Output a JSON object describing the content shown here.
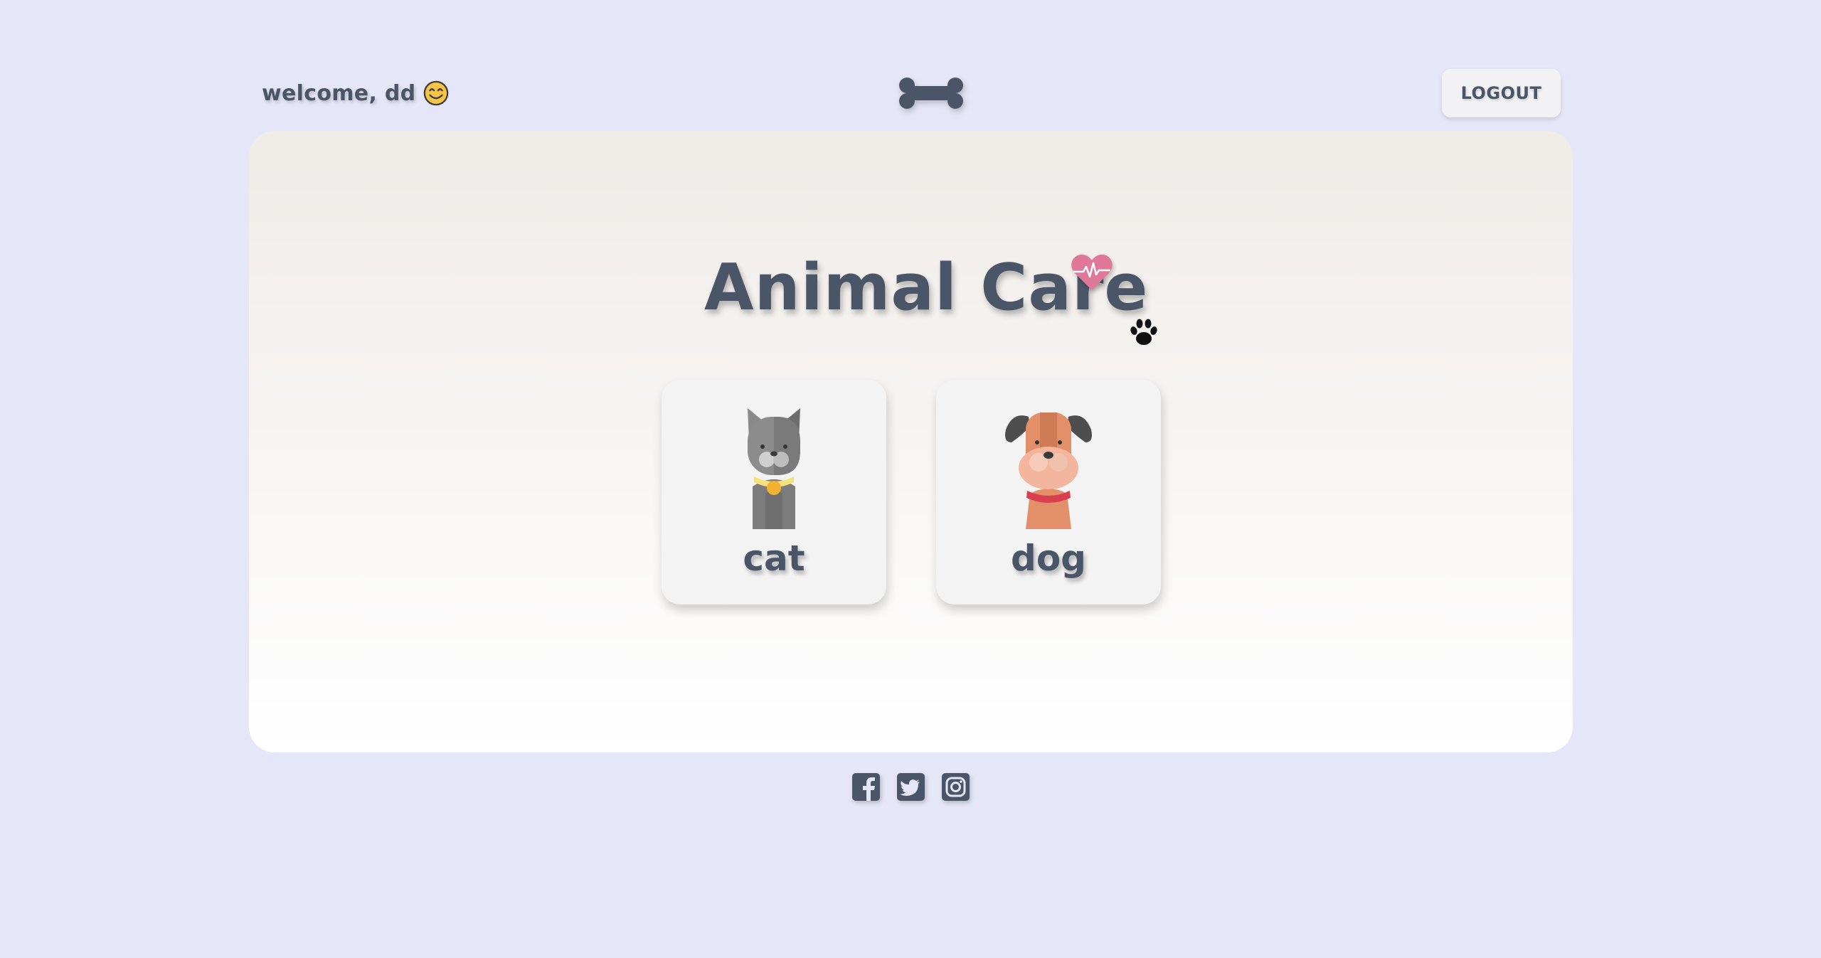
{
  "header": {
    "welcome_text": "welcome, dd",
    "smiley_icon": "smiley-face-icon",
    "logo_icon": "bone-icon",
    "logout_label": "LOGOUT"
  },
  "main": {
    "title": "Animal Care",
    "title_icon": "heart-pulse-icon",
    "decor_icon": "paw-icon",
    "cards": [
      {
        "label": "cat",
        "icon": "cat-icon"
      },
      {
        "label": "dog",
        "icon": "dog-icon"
      }
    ]
  },
  "footer": {
    "social": [
      "facebook-icon",
      "twitter-icon",
      "instagram-icon"
    ]
  },
  "colors": {
    "background": "#e5e6f8",
    "text": "#4b5568",
    "heart": "#e0789a"
  }
}
